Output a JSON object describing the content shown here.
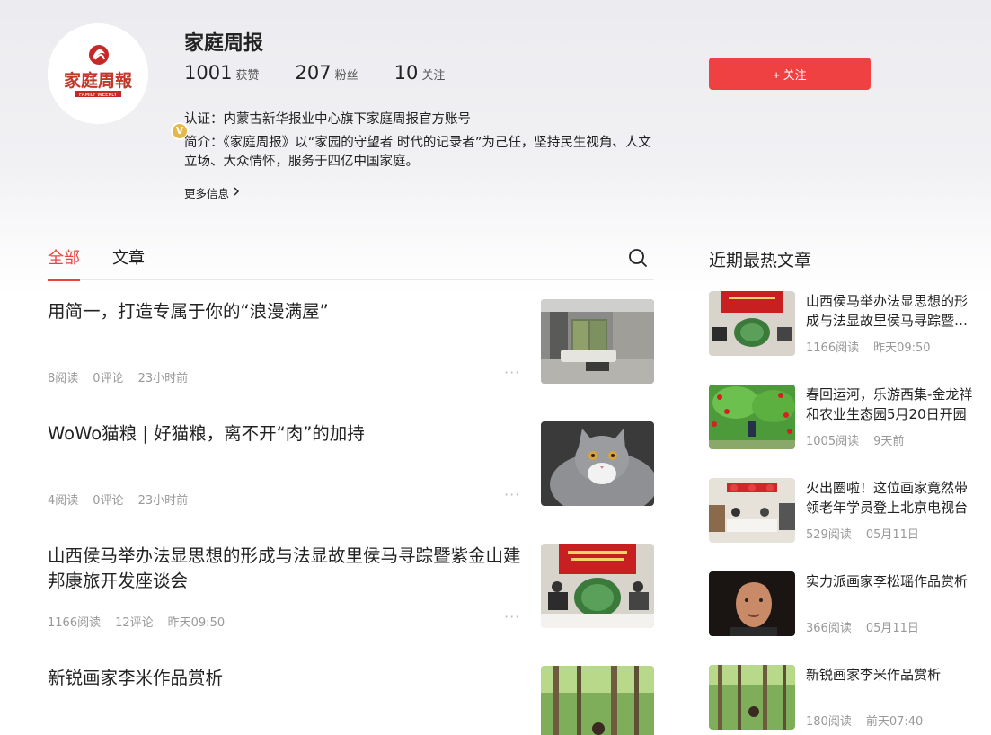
{
  "profile": {
    "name": "家庭周报",
    "logo_text": "家庭周報",
    "logo_sub": "FAMILY WEEKLY",
    "verify_badge": "V",
    "stats": [
      {
        "value": "1001",
        "label": "获赞"
      },
      {
        "value": "207",
        "label": "粉丝"
      },
      {
        "value": "10",
        "label": "关注"
      }
    ],
    "follow_label": "+ 关注",
    "certification": "认证：内蒙古新华报业中心旗下家庭周报官方账号",
    "intro": "简介：《家庭周报》以“家园的守望者 时代的记录者”为己任，坚持民生视角、人文立场、大众情怀，服务于四亿中国家庭。",
    "more_info": "更多信息",
    "more_info_icon": "chevron-right-icon"
  },
  "tabs": [
    {
      "label": "全部",
      "active": true
    },
    {
      "label": "文章",
      "active": false
    }
  ],
  "feed": [
    {
      "title": "用简一，打造专属于你的“浪漫满屋”",
      "meta": [
        "8阅读",
        "0评论",
        "23小时前"
      ],
      "thumb": "living-room-image"
    },
    {
      "title": "WoWo猫粮 | 好猫粮，离不开“肉”的加持",
      "meta": [
        "4阅读",
        "0评论",
        "23小时前"
      ],
      "thumb": "cat-image"
    },
    {
      "title": "山西侯马举办法显思想的形成与法显故里侯马寻踪暨紫金山建邦康旅开发座谈会",
      "meta": [
        "1166阅读",
        "12评论",
        "昨天09:50"
      ],
      "thumb": "meeting-image"
    },
    {
      "title": "新锐画家李米作品赏析",
      "meta": [],
      "thumb": "forest-image"
    }
  ],
  "more_dots": "···",
  "sidebar": {
    "title": "近期最热文章",
    "items": [
      {
        "title": "山西侯马举办法显思想的形成与法显故里侯马寻踪暨紫金山建邦康旅开发座谈会",
        "reads": "1166阅读",
        "time": "昨天09:50",
        "thumb": "meeting-image"
      },
      {
        "title": "春回运河，乐游西集-金龙祥和农业生态园5月20日开园",
        "reads": "1005阅读",
        "time": "9天前",
        "thumb": "cherry-image"
      },
      {
        "title": "火出圈啦！这位画家竟然带领老年学员登上北京电视台",
        "reads": "529阅读",
        "time": "05月11日",
        "thumb": "painting-class-image"
      },
      {
        "title": "实力派画家李松瑶作品赏析",
        "reads": "366阅读",
        "time": "05月11日",
        "thumb": "portrait-image"
      },
      {
        "title": "新锐画家李米作品赏析",
        "reads": "180阅读",
        "time": "前天07:40",
        "thumb": "forest-image"
      }
    ]
  },
  "colors": {
    "accent": "#f04142",
    "meta": "#999999"
  }
}
